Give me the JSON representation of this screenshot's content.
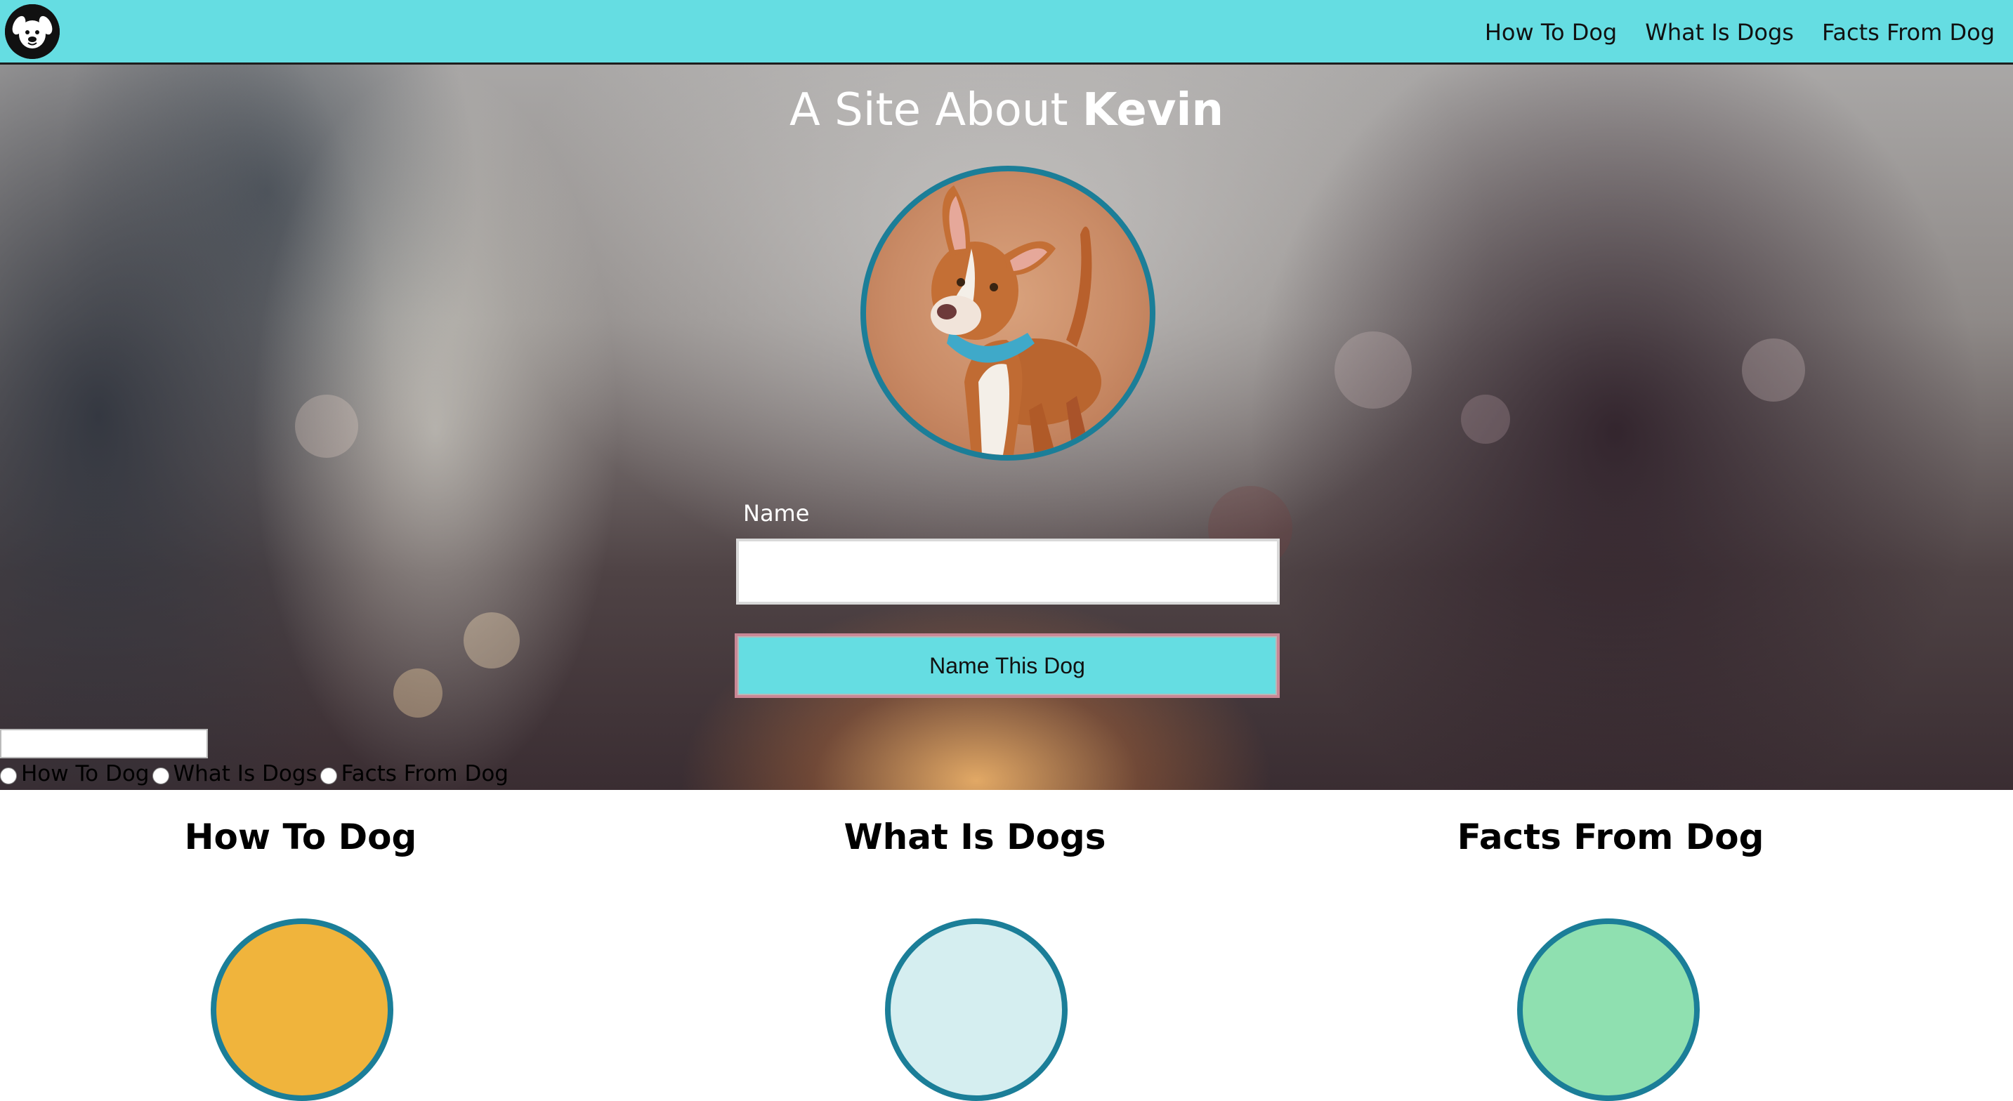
{
  "nav": {
    "logo_icon": "dog-face-logo-icon",
    "links": [
      "How To Dog",
      "What Is Dogs",
      "Facts From Dog"
    ]
  },
  "hero": {
    "title_prefix": "A Site About",
    "title_name": "Kevin",
    "photo_icon": "dog-portrait-photo",
    "name_label": "Name",
    "name_value": "",
    "button_label": "Name This Dog",
    "small_input_value": "",
    "radio_options": [
      "How To Dog",
      "What Is Dogs",
      "Facts From Dog"
    ]
  },
  "sections": [
    {
      "title": "How To Dog",
      "circle_color": "#f0b43c"
    },
    {
      "title": "What Is Dogs",
      "circle_color": "#d5eef0"
    },
    {
      "title": "Facts From Dog",
      "circle_color": "#8fe0b0"
    }
  ],
  "colors": {
    "accent": "#65dde2",
    "ring": "#1b7e98"
  }
}
